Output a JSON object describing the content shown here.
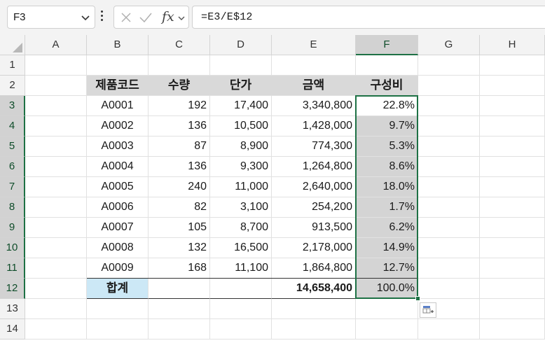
{
  "formula_bar": {
    "name_box": "F3",
    "formula": "=E3/E$12",
    "fx_label": "fx",
    "icons": [
      "chevron-down-icon",
      "more-icon",
      "cancel-icon",
      "enter-icon",
      "fx-icon",
      "chevron-down-icon"
    ]
  },
  "columns": [
    "A",
    "B",
    "C",
    "D",
    "E",
    "F",
    "G",
    "H"
  ],
  "selected_column": "F",
  "rows": [
    "1",
    "2",
    "3",
    "4",
    "5",
    "6",
    "7",
    "8",
    "9",
    "10",
    "11",
    "12",
    "13",
    "14"
  ],
  "table": {
    "headers": [
      "제품코드",
      "수량",
      "단가",
      "금액",
      "구성비"
    ],
    "data": [
      [
        "A0001",
        "192",
        "17,400",
        "3,340,800",
        "22.8%"
      ],
      [
        "A0002",
        "136",
        "10,500",
        "1,428,000",
        "9.7%"
      ],
      [
        "A0003",
        "87",
        "8,900",
        "774,300",
        "5.3%"
      ],
      [
        "A0004",
        "136",
        "9,300",
        "1,264,800",
        "8.6%"
      ],
      [
        "A0005",
        "240",
        "11,000",
        "2,640,000",
        "18.0%"
      ],
      [
        "A0006",
        "82",
        "3,100",
        "254,200",
        "1.7%"
      ],
      [
        "A0007",
        "105",
        "8,700",
        "913,500",
        "6.2%"
      ],
      [
        "A0008",
        "132",
        "16,500",
        "2,178,000",
        "14.9%"
      ],
      [
        "A0009",
        "168",
        "11,100",
        "1,864,800",
        "12.7%"
      ]
    ],
    "total": {
      "label": "합계",
      "amount": "14,658,400",
      "ratio": "100.0%"
    }
  },
  "colors": {
    "selection": "#1e7145",
    "header_fill": "#d9d9d9",
    "total_label_fill": "#cce8f6",
    "selected_range_fill": "#d4d4d4"
  }
}
